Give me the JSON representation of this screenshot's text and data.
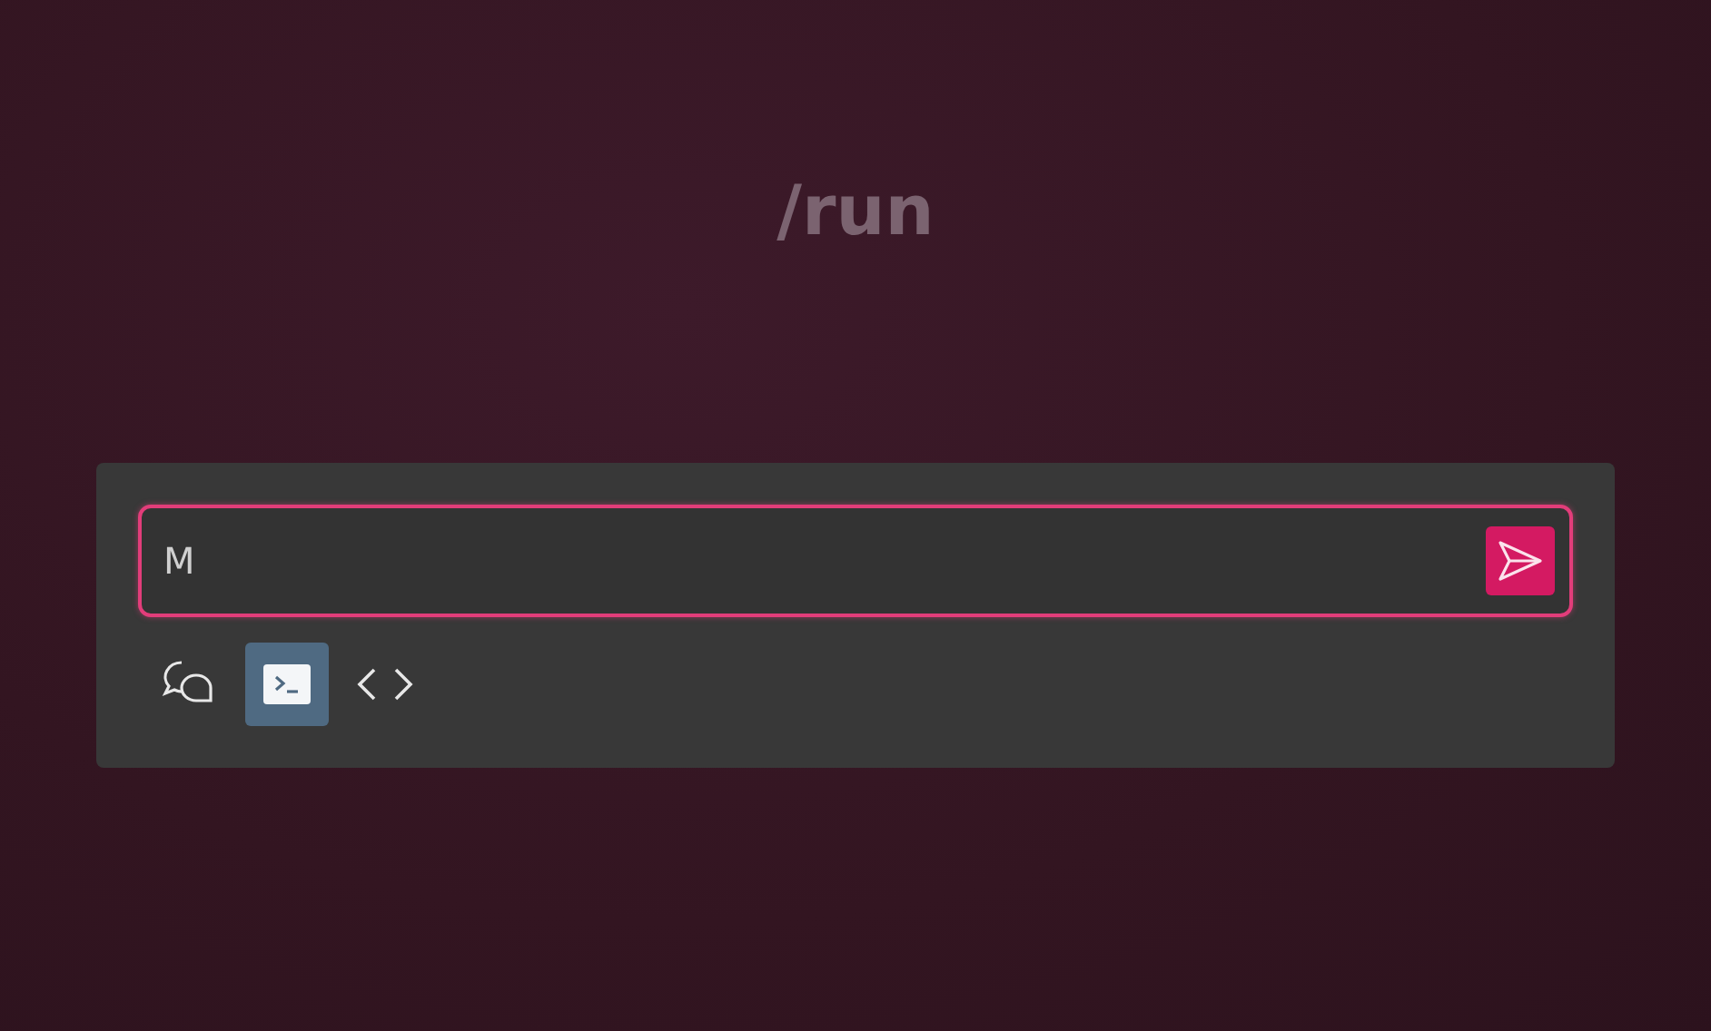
{
  "heading": "/run",
  "prompt": {
    "value": "M"
  },
  "send_button": {
    "enabled": true
  },
  "modes": [
    {
      "kind": "chat",
      "selected": false
    },
    {
      "kind": "terminal",
      "selected": true
    },
    {
      "kind": "code",
      "selected": false
    }
  ]
}
